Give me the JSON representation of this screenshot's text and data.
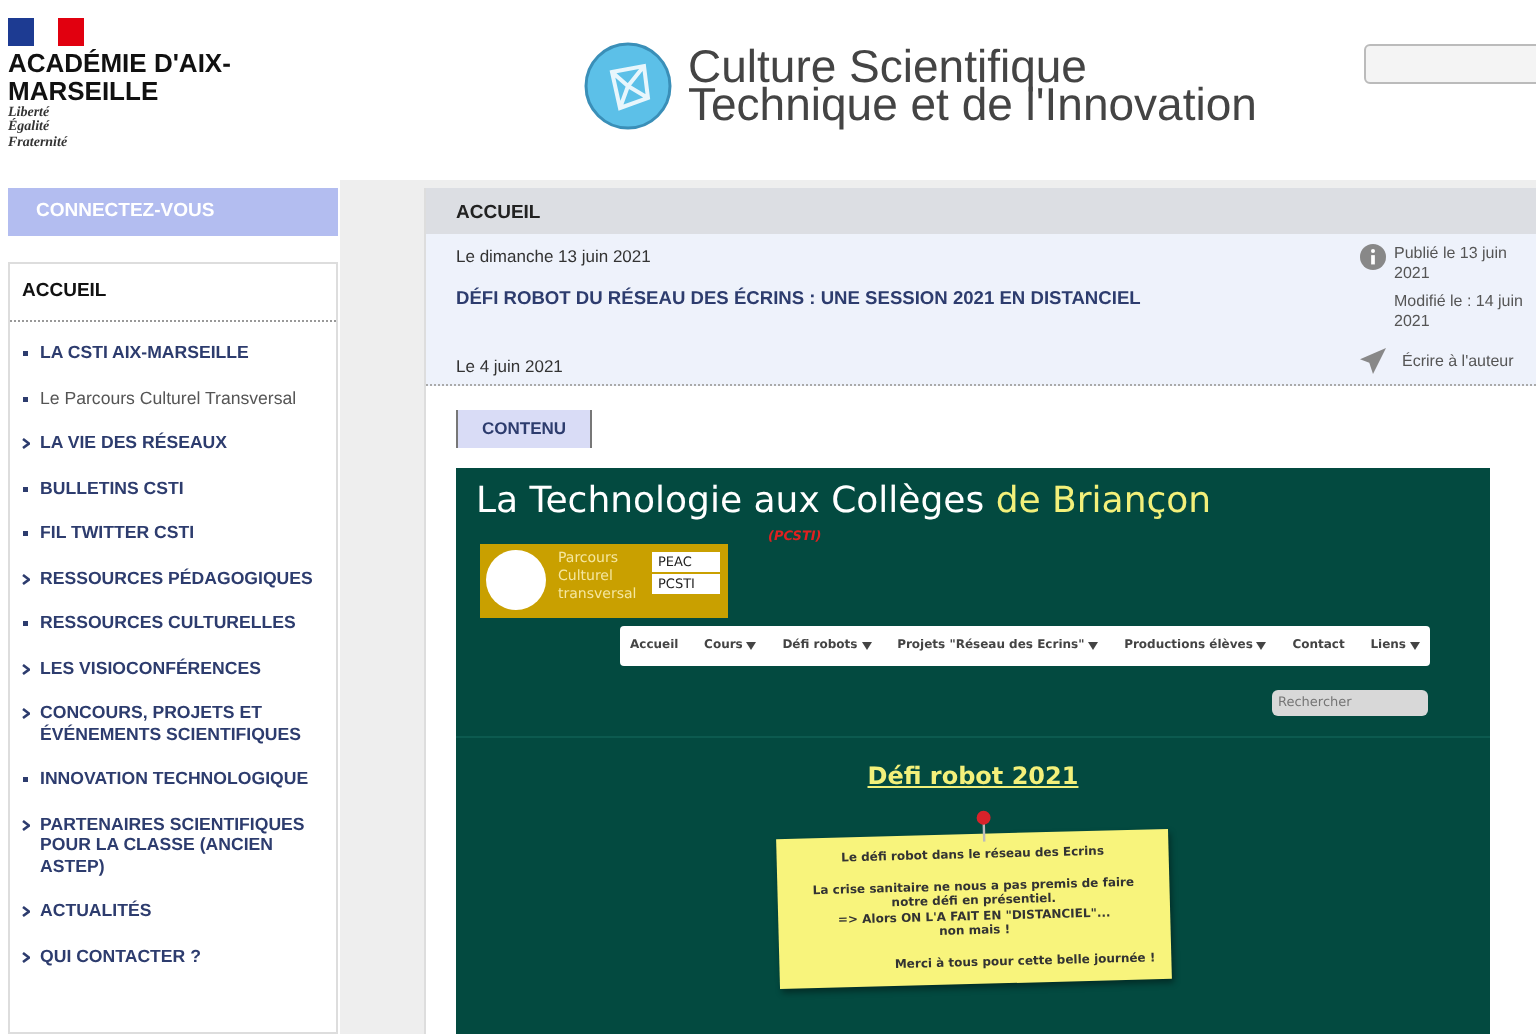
{
  "header": {
    "academy_name": "ACADÉMIE D'AIX-MARSEILLE",
    "motto": [
      "Liberté",
      "Égalité",
      "Fraternité"
    ],
    "site_title_line1": "Culture Scientifique",
    "site_title_line2": "Technique et de l'Innovation"
  },
  "sidebar": {
    "connect_button": "CONNECTEZ-VOUS",
    "menu_title": "ACCUEIL",
    "items": [
      {
        "label": "LA CSTI AIX-MARSEILLE",
        "kind": "bullet",
        "bold": true
      },
      {
        "label": "Le Parcours Culturel Transversal",
        "kind": "bullet",
        "bold": false
      },
      {
        "label": "LA VIE DES RÉSEAUX",
        "kind": "arrow",
        "bold": true
      },
      {
        "label": "BULLETINS CSTI",
        "kind": "bullet",
        "bold": true
      },
      {
        "label": "FIL TWITTER CSTI",
        "kind": "bullet",
        "bold": true
      },
      {
        "label": "RESSOURCES PÉDAGOGIQUES",
        "kind": "arrow",
        "bold": true
      },
      {
        "label": "RESSOURCES CULTURELLES",
        "kind": "bullet",
        "bold": true
      },
      {
        "label": "LES VISIOCONFÉRENCES",
        "kind": "arrow",
        "bold": true
      },
      {
        "label": "CONCOURS, PROJETS ET ÉVÉNEMENTS SCIENTIFIQUES",
        "kind": "arrow",
        "bold": true
      },
      {
        "label": "INNOVATION TECHNOLOGIQUE",
        "kind": "bullet",
        "bold": true
      },
      {
        "label": "PARTENAIRES SCIENTIFIQUES POUR LA CLASSE (ANCIEN ASTEP)",
        "kind": "arrow",
        "bold": true
      },
      {
        "label": "ACTUALITÉS",
        "kind": "arrow",
        "bold": true
      },
      {
        "label": "QUI CONTACTER ?",
        "kind": "arrow",
        "bold": true
      }
    ]
  },
  "main": {
    "breadcrumb": "ACCUEIL",
    "date": "Le  dimanche 13 juin 2021",
    "article_title": "DÉFI ROBOT DU RÉSEAU DES ÉCRINS : UNE SESSION 2021 EN DISTANCIEL",
    "article_date": "Le 4 juin 2021",
    "published": "Publié le 13 juin 2021",
    "modified": "Modifié le : 14 juin 2021",
    "write_author": "Écrire à l'auteur",
    "content_tab": "CONTENU"
  },
  "embedded_site": {
    "title_part1": "La Technologie aux Collèges",
    "title_part2": "de Briançon",
    "subtitle": "(PCSTI)",
    "badge_text": "Parcours Culturel transversal",
    "badge_tags": [
      "PEAC",
      "PCSTI"
    ],
    "nav": [
      {
        "label": "Accueil",
        "dropdown": false
      },
      {
        "label": "Cours",
        "dropdown": true
      },
      {
        "label": "Défi robots",
        "dropdown": true
      },
      {
        "label": "Projets \"Réseau des Ecrins\"",
        "dropdown": true
      },
      {
        "label": "Productions élèves",
        "dropdown": true
      },
      {
        "label": "Contact",
        "dropdown": false
      },
      {
        "label": "Liens",
        "dropdown": true
      }
    ],
    "search_placeholder": "Rechercher",
    "heading": "Défi robot 2021",
    "note": {
      "title": "Le défi robot dans le réseau des Ecrins",
      "lines": [
        "La crise sanitaire ne nous a pas premis de faire notre défi en présentiel.",
        "=> Alors ON L'A FAIT EN \"DISTANCIEL\"...",
        "non mais !"
      ],
      "thanks": "Merci à tous pour cette belle journée !"
    }
  }
}
